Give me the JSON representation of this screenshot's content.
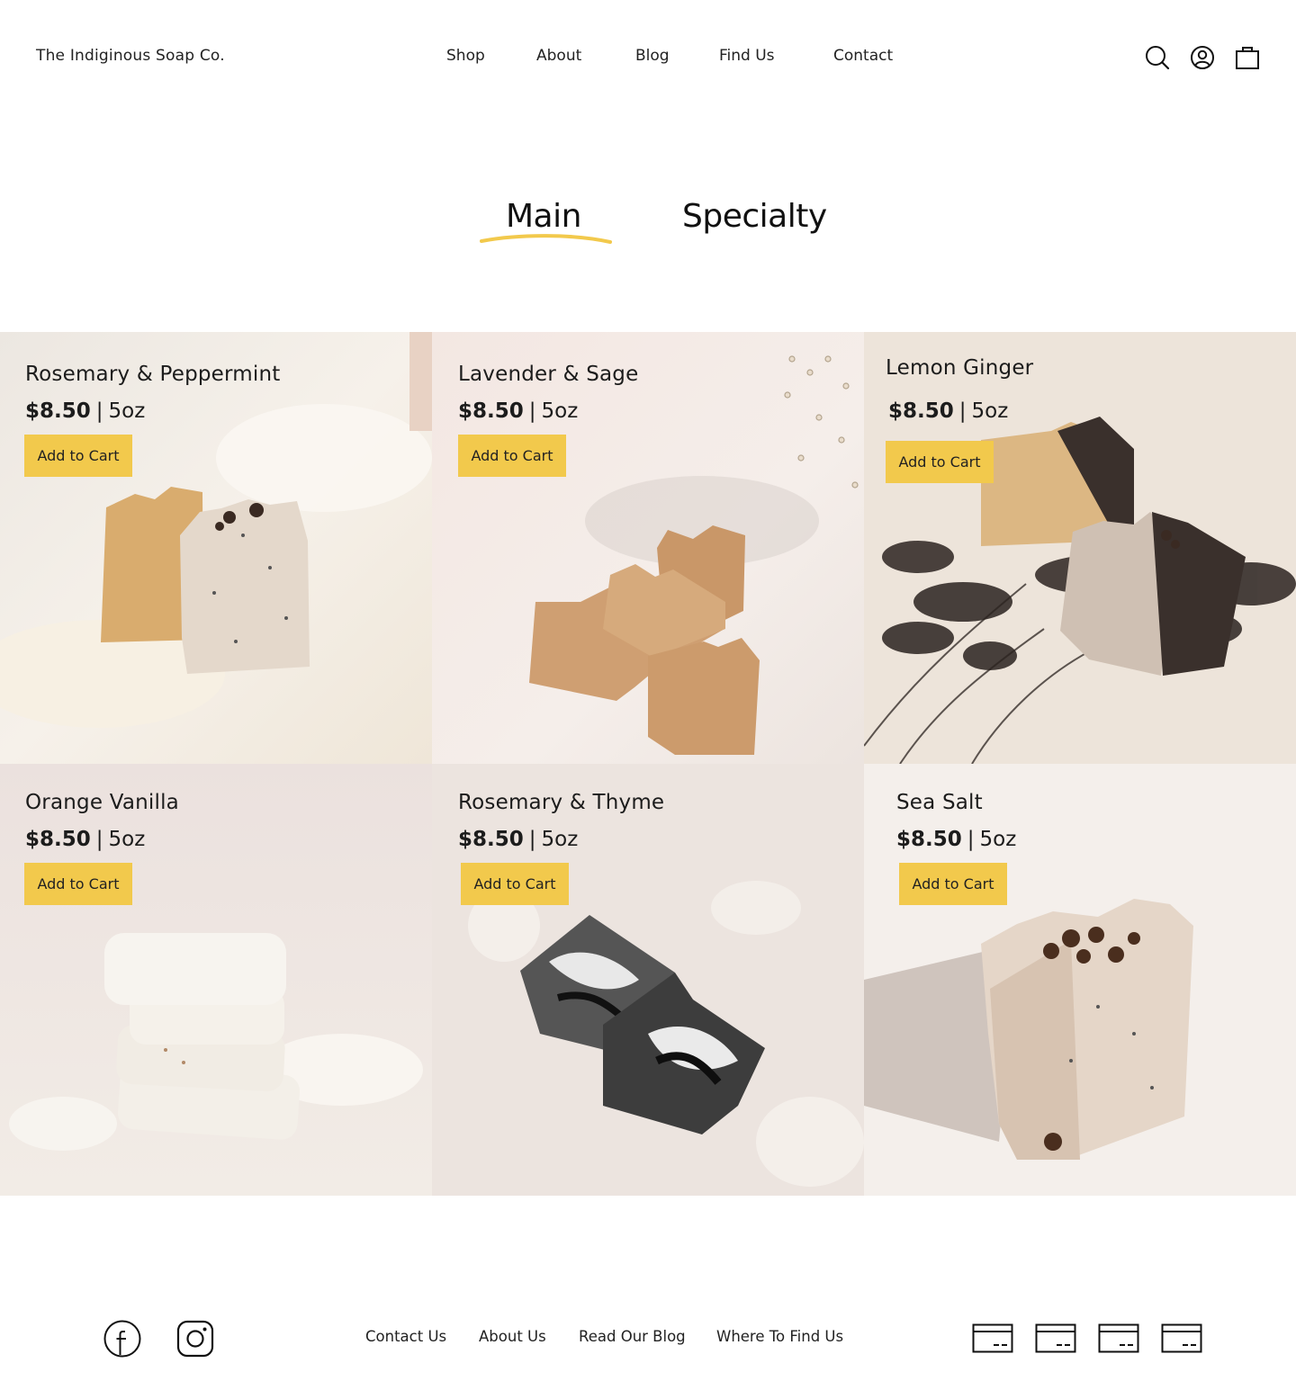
{
  "header": {
    "brand": "The Indiginous Soap Co.",
    "nav": [
      "Shop",
      "About",
      "Blog",
      "Find Us",
      "Contact"
    ],
    "icons": [
      "search-icon",
      "account-icon",
      "cart-icon"
    ]
  },
  "tabs": {
    "items": [
      "Main",
      "Specialty"
    ],
    "active": "Main",
    "accent_color": "#f2c94c"
  },
  "products": [
    {
      "name": "Rosemary & Peppermint",
      "price": "$8.50",
      "size": "5oz",
      "cta": "Add to Cart"
    },
    {
      "name": "Lavender & Sage",
      "price": "$8.50",
      "size": "5oz",
      "cta": "Add to Cart"
    },
    {
      "name": "Lemon Ginger",
      "price": "$8.50",
      "size": "5oz",
      "cta": "Add to Cart"
    },
    {
      "name": "Orange Vanilla",
      "price": "$8.50",
      "size": "5oz",
      "cta": "Add to Cart"
    },
    {
      "name": "Rosemary & Thyme",
      "price": "$8.50",
      "size": "5oz",
      "cta": "Add to Cart"
    },
    {
      "name": "Sea Salt",
      "price": "$8.50",
      "size": "5oz",
      "cta": "Add to Cart"
    }
  ],
  "product_separator": "|",
  "footer": {
    "social": [
      "facebook-icon",
      "instagram-icon"
    ],
    "links": [
      "Contact Us",
      "About Us",
      "Read Our Blog",
      "Where To Find Us"
    ],
    "payment_icons": [
      "card-icon",
      "card-icon",
      "card-icon",
      "card-icon"
    ]
  },
  "colors": {
    "button": "#f2c94c",
    "text": "#1c1c1c",
    "background": "#ffffff"
  }
}
